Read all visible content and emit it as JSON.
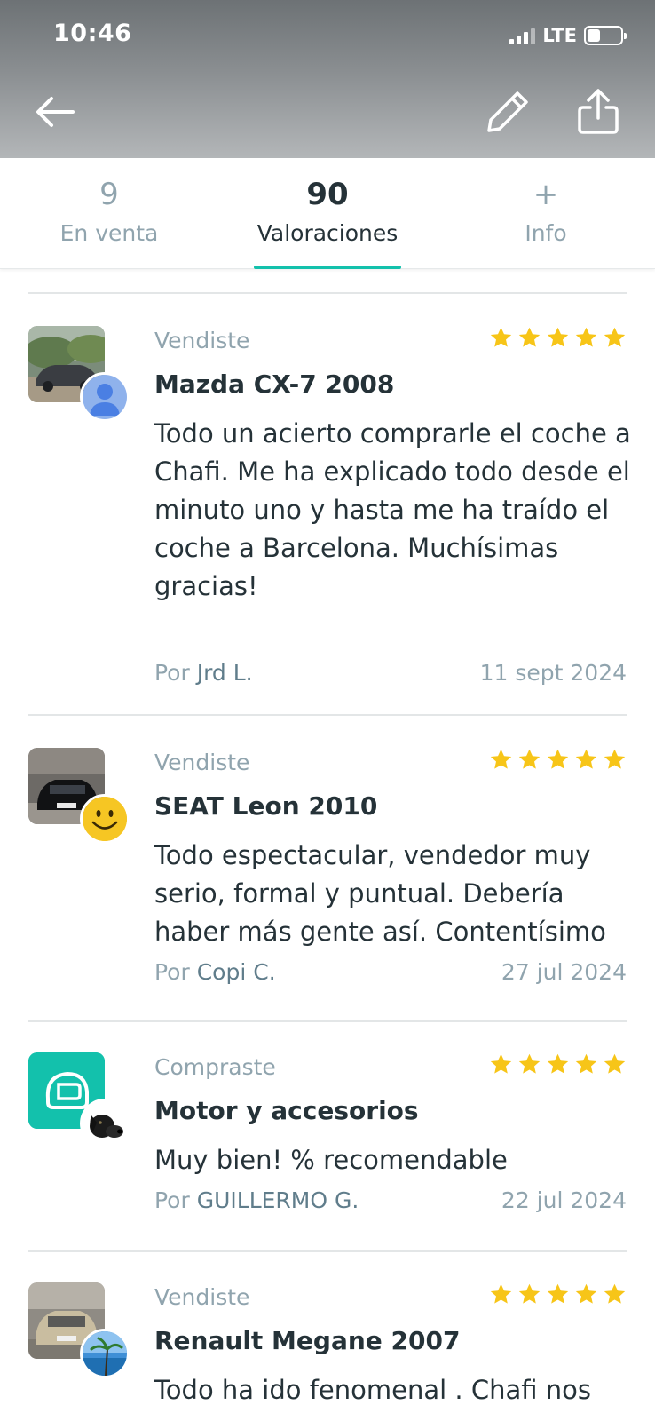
{
  "status_bar": {
    "time": "10:46",
    "network": "LTE"
  },
  "tabs": [
    {
      "value": "9",
      "label": "En venta",
      "active": false
    },
    {
      "value": "90",
      "label": "Valoraciones",
      "active": true
    },
    {
      "value": "+",
      "label": "Info",
      "active": false
    }
  ],
  "reviews": [
    {
      "type": "Vendiste",
      "title": "Mazda CX-7 2008",
      "text": "Todo un acierto comprarle el coche a Chafi. Me ha explicado todo desde el minuto uno y hasta me ha traído el coche a Barcelona. Muchísimas gracias!",
      "by_prefix": "Por",
      "author": "Jrd L.",
      "date": "11 sept 2024",
      "stars": 5
    },
    {
      "type": "Vendiste",
      "title": "SEAT Leon 2010",
      "text": "Todo espectacular, vendedor muy serio, formal y puntual. Debería haber más gente así. Contentísimo",
      "by_prefix": "Por",
      "author": "Copi C.",
      "date": "27 jul 2024",
      "stars": 5
    },
    {
      "type": "Compraste",
      "title": "Motor y accesorios",
      "text": "Muy bien! % recomendable",
      "by_prefix": "Por",
      "author": "GUILLERMO G.",
      "date": "22 jul 2024",
      "stars": 5
    },
    {
      "type": "Vendiste",
      "title": "Renault Megane 2007",
      "text": "Todo ha ido fenomenal . Chafi nos",
      "stars": 5
    }
  ],
  "colors": {
    "accent": "#13c1ac",
    "star": "#f7c518",
    "muted": "#90a4ae",
    "text": "#253238"
  },
  "icons": [
    "back-arrow-icon",
    "pencil-icon",
    "share-icon",
    "star-icon",
    "user-placeholder-icon",
    "helmet-category-icon"
  ]
}
